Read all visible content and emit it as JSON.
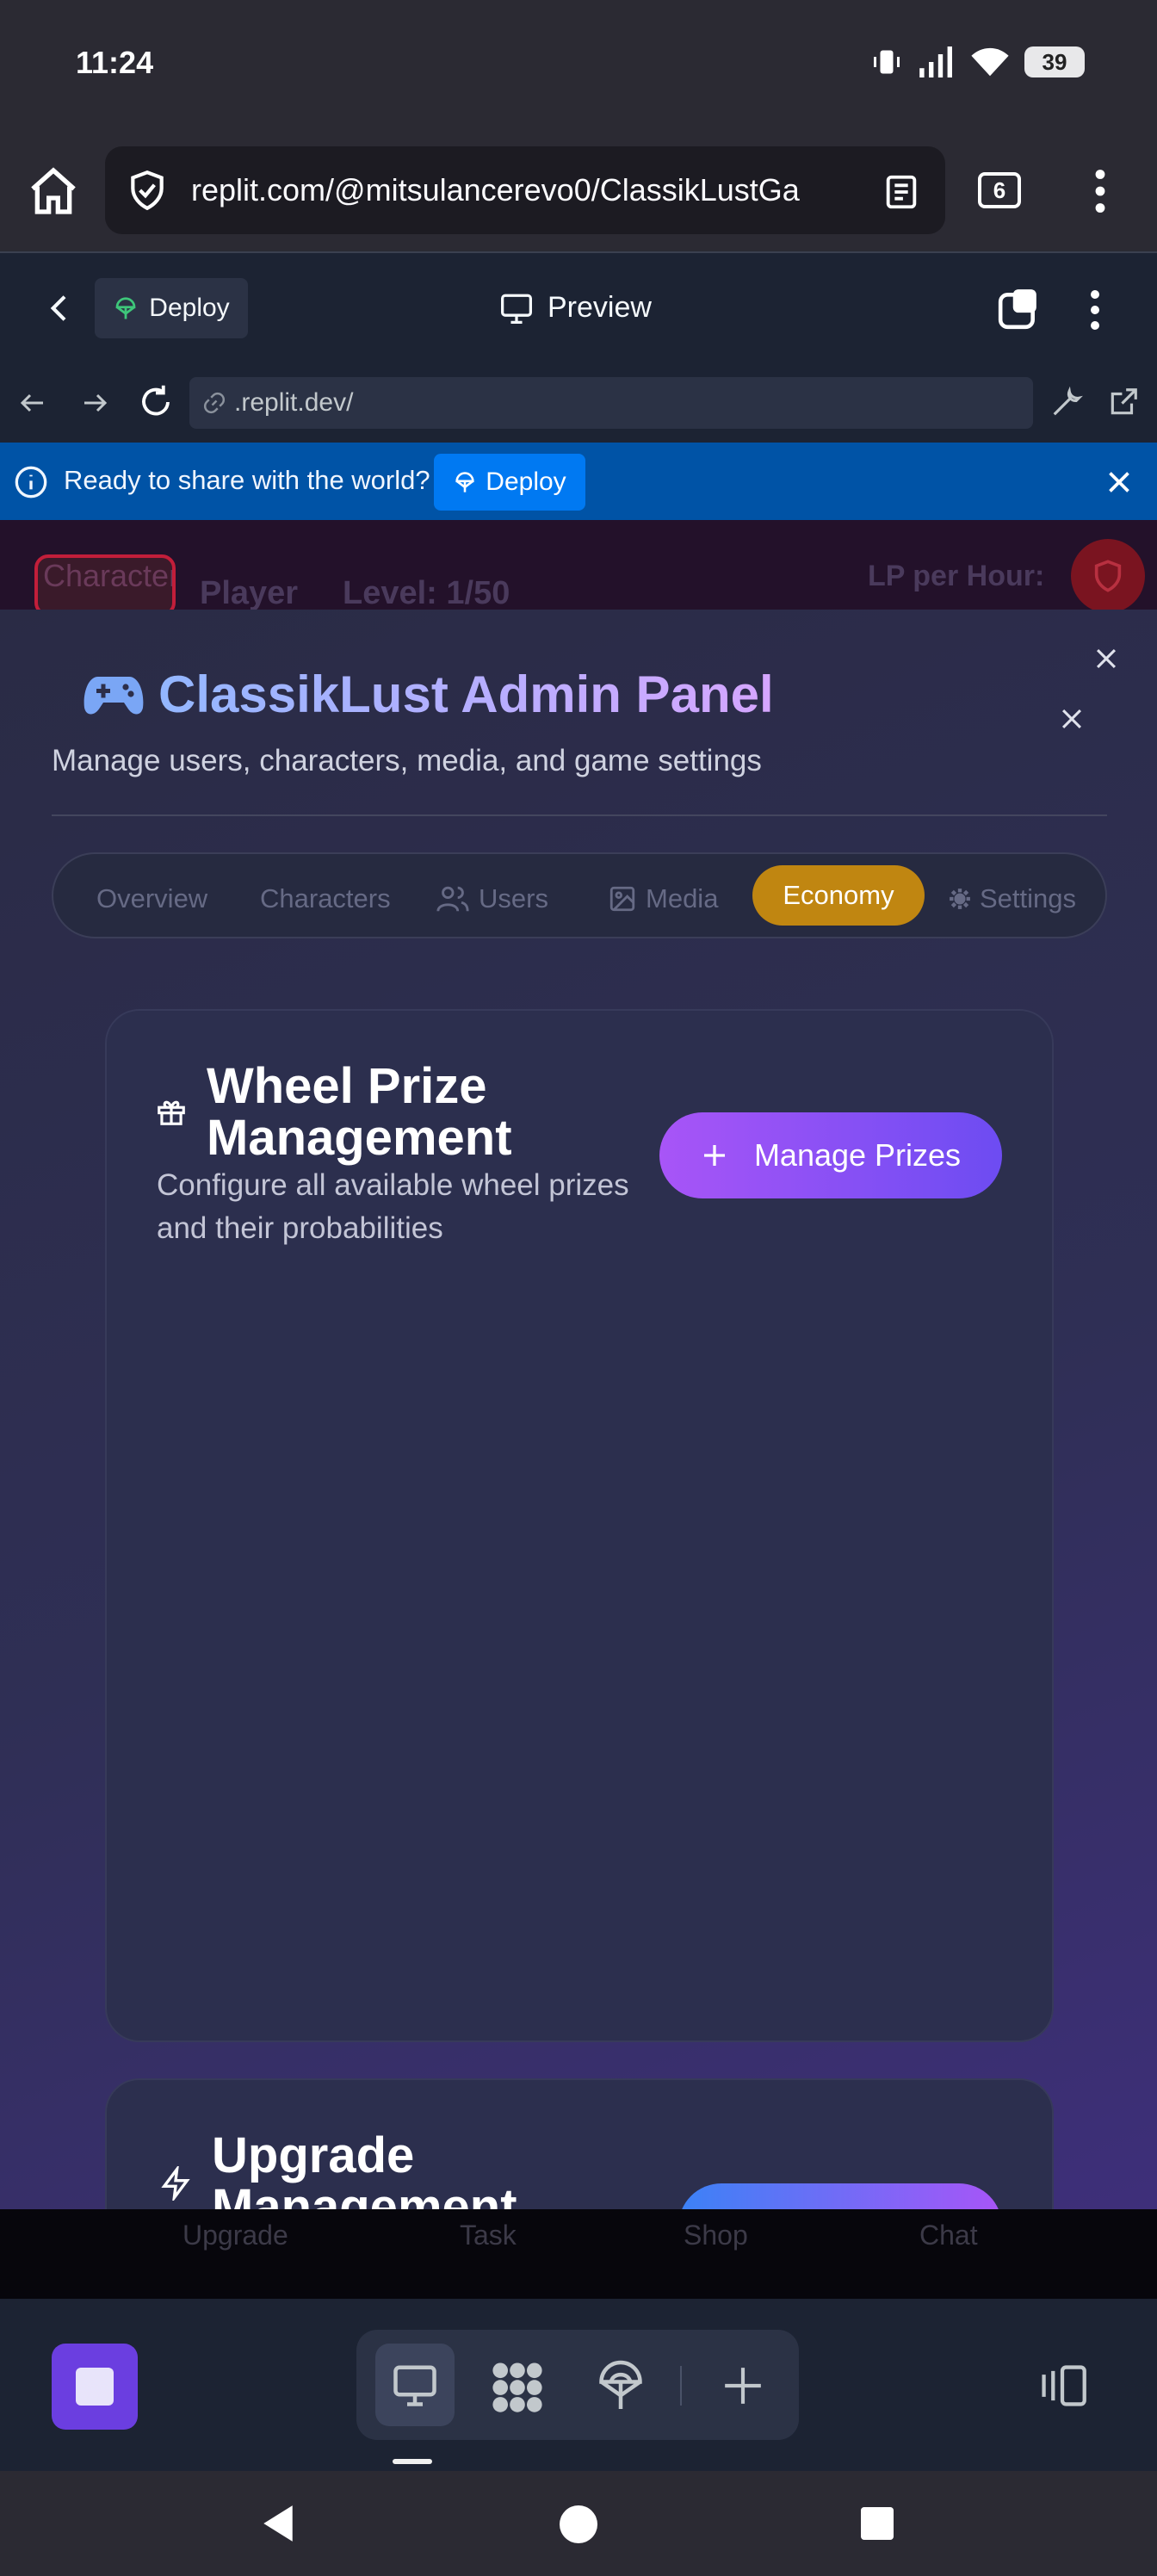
{
  "status_bar": {
    "time": "11:24",
    "battery": "39"
  },
  "browser": {
    "url": "replit.com/@mitsulancerevo0/ClassikLustGa",
    "tab_count": "6"
  },
  "replit_header": {
    "deploy_label": "Deploy",
    "title": "Preview"
  },
  "replit_nav": {
    "dev_url": ".replit.dev/"
  },
  "banner": {
    "text": "Ready to share with the world?",
    "deploy_label": "Deploy"
  },
  "game_header": {
    "character_button": "Characters",
    "player": "Player",
    "level": "Level: 1/50",
    "lp_label": "LP per Hour:"
  },
  "admin": {
    "title": "ClassikLust Admin Panel",
    "subtitle": "Manage users, characters, media, and game settings",
    "tabs": [
      {
        "label": "Overview"
      },
      {
        "label": "Characters"
      },
      {
        "label": "Users"
      },
      {
        "label": "Media"
      },
      {
        "label": "Economy"
      },
      {
        "label": "Settings"
      }
    ],
    "active_tab": "Economy"
  },
  "wheel_card": {
    "title": "Wheel Prize Management",
    "description": "Configure all available wheel prizes and their probabilities",
    "button_label": "Manage Prizes"
  },
  "upgrade_card": {
    "title": "Upgrade Management"
  },
  "game_nav": {
    "items": [
      "Upgrade",
      "Task",
      "Shop",
      "Chat"
    ]
  },
  "colors": {
    "accent_economy": "#c08611",
    "banner": "#0053a6",
    "manage_gradient_start": "#a855f7",
    "manage_gradient_end": "#6d4cf2"
  }
}
